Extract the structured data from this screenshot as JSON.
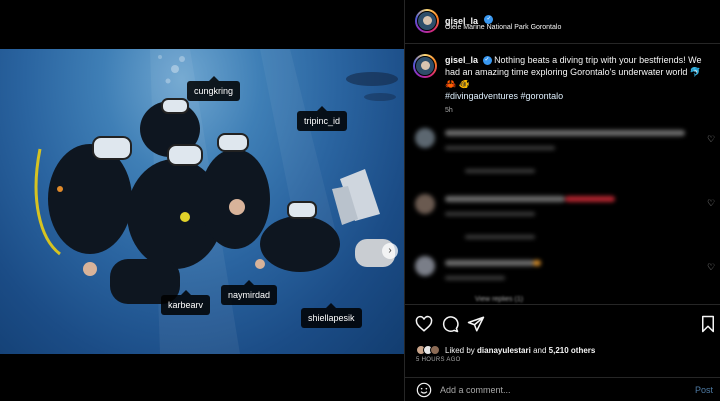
{
  "post": {
    "username": "gisel_la",
    "location": "Olele Marine National Park Gorontalo",
    "caption_text": "Nothing beats a diving trip with your bestfriends! We had an amazing time exploring Gorontalo's underwater world 🐬 🦀 🐠",
    "hashtags": "#divingadventures #gorontalo",
    "caption_time": "5h",
    "tags": [
      "cungkring",
      "tripinc_id",
      "karbearv",
      "naymirdad",
      "shiellapesik"
    ]
  },
  "comments": {
    "view_replies": "View replies (1)"
  },
  "likes": {
    "prefix": "Liked by",
    "first_user": "dianayulestari",
    "connector": "and",
    "others": "5,210 others",
    "date": "5 HOURS AGO"
  },
  "comment_bar": {
    "placeholder": "Add a comment...",
    "post_label": "Post"
  },
  "carousel": {
    "count": 10,
    "active_index": 0
  },
  "colors": {
    "accent": "#3897f0",
    "background": "#000000",
    "border": "#262626",
    "post_disabled": "#4e7aa3"
  },
  "icons": [
    "more-horizontal-icon",
    "heart-icon",
    "comment-icon",
    "share-icon",
    "bookmark-icon",
    "emoji-icon",
    "chevron-right-icon",
    "user-tag-icon",
    "verified-badge-icon"
  ]
}
